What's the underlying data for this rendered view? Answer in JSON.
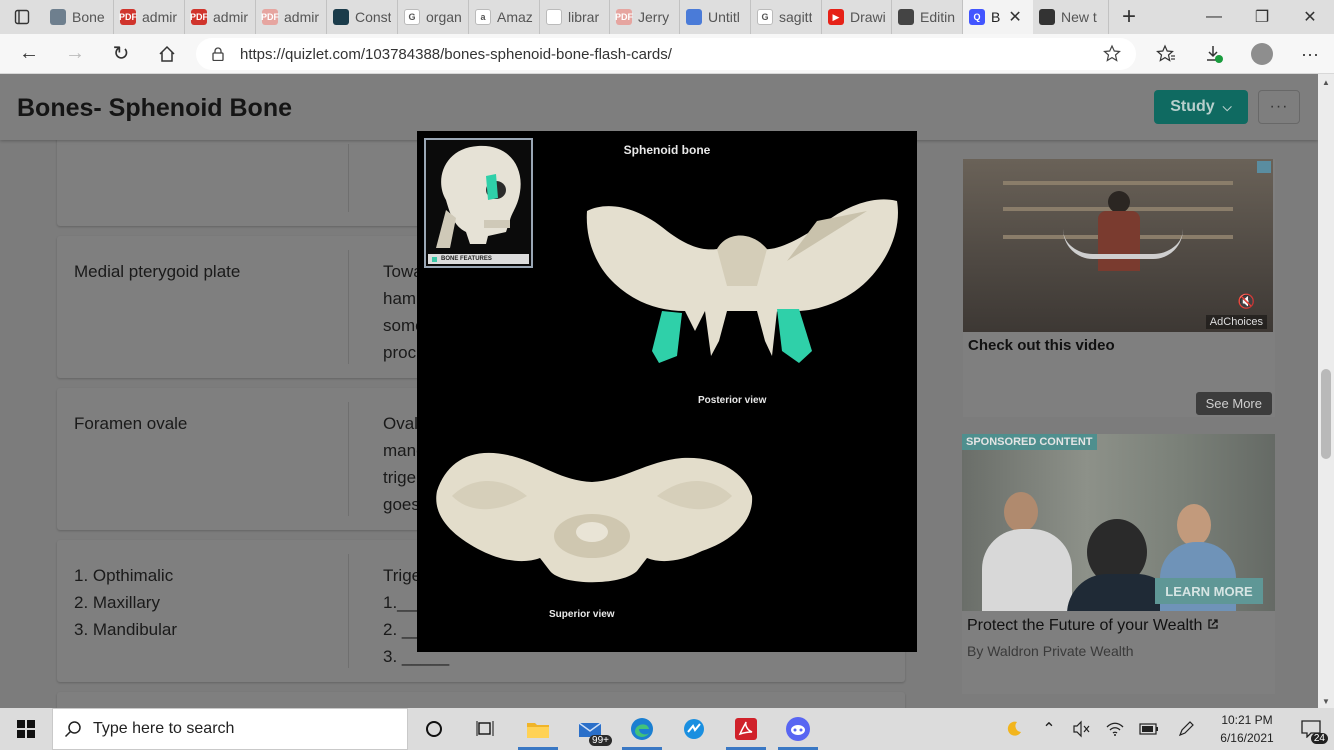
{
  "browser": {
    "tabs": [
      {
        "title": "Bone",
        "fav_color": "#6e7f8e",
        "fav_text": ""
      },
      {
        "title": "admir",
        "fav_color": "#d0342c",
        "fav_text": "PDF"
      },
      {
        "title": "admir",
        "fav_color": "#d0342c",
        "fav_text": "PDF"
      },
      {
        "title": "admir",
        "fav_color": "#e6a5a0",
        "fav_text": "PDF"
      },
      {
        "title": "Const",
        "fav_color": "#1b3c4b",
        "fav_text": ""
      },
      {
        "title": "organ",
        "fav_color": "#ffffff",
        "fav_text": "G"
      },
      {
        "title": "Amaz",
        "fav_color": "#ffffff",
        "fav_text": "a"
      },
      {
        "title": "librar",
        "fav_color": "#ffffff",
        "fav_text": ""
      },
      {
        "title": "Jerry",
        "fav_color": "#e6a5a0",
        "fav_text": "PDF"
      },
      {
        "title": "Untitl",
        "fav_color": "#4a7bd8",
        "fav_text": ""
      },
      {
        "title": "sagitt",
        "fav_color": "#ffffff",
        "fav_text": "G"
      },
      {
        "title": "Drawi",
        "fav_color": "#e62117",
        "fav_text": "▶"
      },
      {
        "title": "Editin",
        "fav_color": "#444444",
        "fav_text": ""
      },
      {
        "title": "B",
        "fav_color": "#4255ff",
        "fav_text": "Q",
        "active": true
      },
      {
        "title": "New t",
        "fav_color": "#333333",
        "fav_text": ""
      }
    ],
    "url": "https://quizlet.com/103784388/bones-sphenoid-bone-flash-cards/"
  },
  "page": {
    "title": "Bones- Sphenoid Bone",
    "study_label": "Study",
    "more_label": "···",
    "cards": [
      {
        "term": "",
        "definition": []
      },
      {
        "term": "Medial pterygoid plate",
        "definition": [
          "Towa",
          "hamu",
          "some",
          "proc"
        ]
      },
      {
        "term": "Foramen ovale",
        "definition": [
          "Oval",
          "mand",
          "trige",
          "goes"
        ]
      },
      {
        "term": [
          "1. Opthimalic",
          "2. Maxillary",
          "3. Mandibular"
        ],
        "definition": [
          "Trige",
          "1.___",
          "2. __",
          "3. _____"
        ]
      }
    ]
  },
  "ads": {
    "ad1": {
      "caption": "Check out this video",
      "adchoices": "AdChoices",
      "see_more": "See More"
    },
    "ad2": {
      "sponsored": "SPONSORED CONTENT",
      "learn_more": "LEARN MORE",
      "headline": "Protect the Future of your Wealth",
      "byline": "By Waldron Private Wealth"
    }
  },
  "lightbox": {
    "title": "Sphenoid bone",
    "thumb_label": "BONE FEATURES",
    "posterior_label": "Posterior view",
    "superior_label": "Superior view"
  },
  "taskbar": {
    "search_placeholder": "Type here to search",
    "mail_badge": "99+",
    "time": "10:21 PM",
    "date": "6/16/2021",
    "notif_count": "24"
  }
}
